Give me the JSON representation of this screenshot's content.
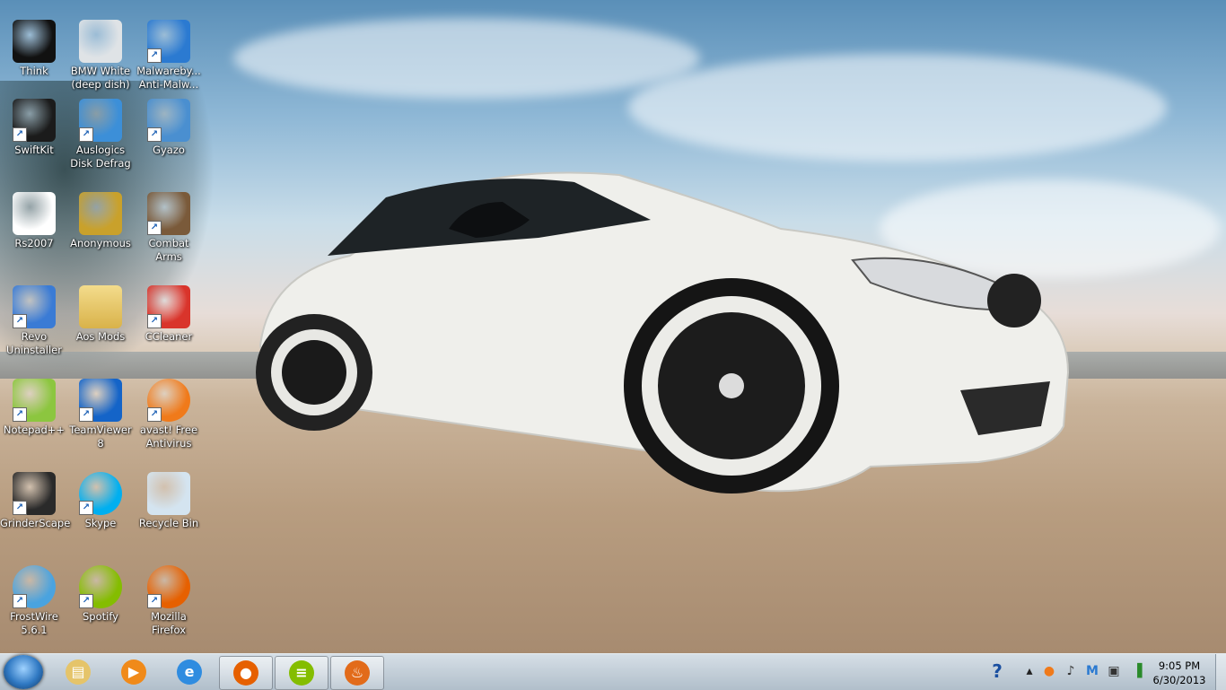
{
  "desktop_icons": [
    {
      "label": "Think",
      "icon": "think-app-icon",
      "shortcut": false
    },
    {
      "label": "BMW White (deep dish)",
      "icon": "image-file-icon",
      "shortcut": false
    },
    {
      "label": "Malwareby... Anti-Malw...",
      "icon": "malwarebytes-icon",
      "shortcut": true
    },
    {
      "label": "SwiftKit",
      "icon": "swiftkit-icon",
      "shortcut": true
    },
    {
      "label": "Auslogics Disk Defrag",
      "icon": "auslogics-icon",
      "shortcut": true
    },
    {
      "label": "Gyazo",
      "icon": "gyazo-icon",
      "shortcut": true
    },
    {
      "label": "Rs2007",
      "icon": "java-file-icon",
      "shortcut": false
    },
    {
      "label": "Anonymous",
      "icon": "anonymous-icon",
      "shortcut": false
    },
    {
      "label": "Combat Arms",
      "icon": "combat-arms-icon",
      "shortcut": true
    },
    {
      "label": "Revo Uninstaller",
      "icon": "revo-uninstaller-icon",
      "shortcut": true
    },
    {
      "label": "Aos Mods",
      "icon": "folder-icon",
      "shortcut": false
    },
    {
      "label": "CCleaner",
      "icon": "ccleaner-icon",
      "shortcut": true
    },
    {
      "label": "Notepad++",
      "icon": "notepadpp-icon",
      "shortcut": true
    },
    {
      "label": "TeamViewer 8",
      "icon": "teamviewer-icon",
      "shortcut": true
    },
    {
      "label": "avast! Free Antivirus",
      "icon": "avast-icon",
      "shortcut": true
    },
    {
      "label": "GrinderScape",
      "icon": "grinderscape-icon",
      "shortcut": true
    },
    {
      "label": "Skype",
      "icon": "skype-icon",
      "shortcut": true
    },
    {
      "label": "Recycle Bin",
      "icon": "recycle-bin-icon",
      "shortcut": false
    },
    {
      "label": "FrostWire 5.6.1",
      "icon": "frostwire-icon",
      "shortcut": true
    },
    {
      "label": "Spotify",
      "icon": "spotify-icon",
      "shortcut": true
    },
    {
      "label": "Mozilla Firefox",
      "icon": "firefox-icon",
      "shortcut": true
    }
  ],
  "taskbar": {
    "start_icon": "windows-start-icon",
    "items": [
      {
        "icon": "explorer-folder-icon",
        "active": false
      },
      {
        "icon": "media-player-icon",
        "active": false
      },
      {
        "icon": "internet-explorer-icon",
        "active": false
      },
      {
        "icon": "firefox-icon",
        "active": true
      },
      {
        "icon": "spotify-icon",
        "active": true
      },
      {
        "icon": "java-icon",
        "active": true
      }
    ],
    "tray_icons": [
      "intel-help-icon",
      "show-hidden-icons-chevron",
      "avast-tray-icon",
      "volume-icon",
      "malwarebytes-tray-icon",
      "device-icon",
      "network-signal-icon"
    ],
    "time": "9:05 PM",
    "date": "6/30/2013"
  },
  "colors": {
    "label_text": "#ffffff",
    "car_body": "#f2f2ee",
    "taskbar": "#c3ced8"
  }
}
